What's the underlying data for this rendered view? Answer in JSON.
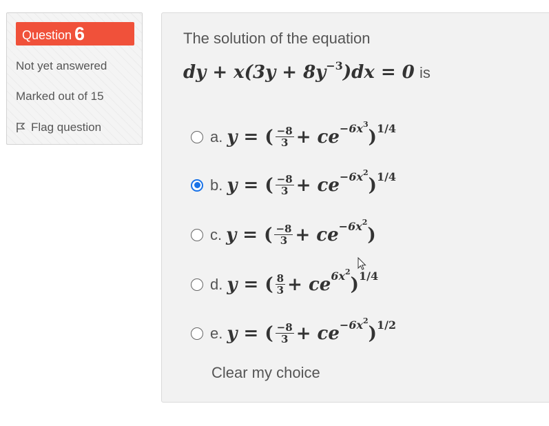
{
  "info": {
    "question_prefix": "Question",
    "question_number": "6",
    "state": "Not yet answered",
    "grade": "Marked out of 15",
    "flag_label": "Flag question"
  },
  "question": {
    "text": "The solution of the equation",
    "equation": {
      "lhs": "dy + x(3y + 8y",
      "exp": "−3",
      "rest": ")dx = 0",
      "suffix": "is"
    }
  },
  "answers": [
    {
      "label": "a.",
      "checked": false,
      "num": "−8",
      "den": "3",
      "exp_base": "−6x",
      "exp_pow": "3",
      "outer": "1/4"
    },
    {
      "label": "b.",
      "checked": true,
      "num": "−8",
      "den": "3",
      "exp_base": "−6x",
      "exp_pow": "2",
      "outer": "1/4"
    },
    {
      "label": "c.",
      "checked": false,
      "num": "−8",
      "den": "3",
      "exp_base": "−6x",
      "exp_pow": "2",
      "outer": ""
    },
    {
      "label": "d.",
      "checked": false,
      "num": "8",
      "den": "3",
      "exp_base": "6x",
      "exp_pow": "2",
      "outer": "1/4"
    },
    {
      "label": "e.",
      "checked": false,
      "num": "−8",
      "den": "3",
      "exp_base": "−6x",
      "exp_pow": "2",
      "outer": "1/2"
    }
  ],
  "clear_label": "Clear my choice",
  "colors": {
    "accent": "#f0513a",
    "radio_selected": "#1a73e8"
  }
}
